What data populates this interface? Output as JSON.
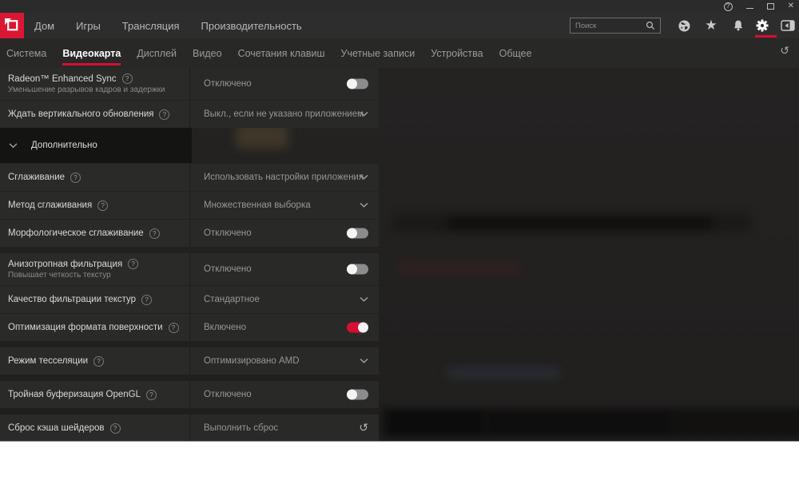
{
  "colors": {
    "accent": "#d60f33",
    "logo_red": "#da1733"
  },
  "titlebar": {
    "help_label": "?",
    "close_label": "✕"
  },
  "navbar": {
    "items": [
      "Дом",
      "Игры",
      "Трансляция",
      "Производительность"
    ],
    "search": {
      "placeholder": "Поиск",
      "icon": "search-icon"
    },
    "icons": [
      "globe-icon",
      "star-icon",
      "bell-icon",
      "gear-icon",
      "side-panel-icon"
    ],
    "active_icon": "gear-icon",
    "star_glyph": "★"
  },
  "tabbar": {
    "tabs": [
      {
        "label": "Система",
        "active": false
      },
      {
        "label": "Видеокарта",
        "active": true
      },
      {
        "label": "Дисплей",
        "active": false
      },
      {
        "label": "Видео",
        "active": false
      },
      {
        "label": "Сочетания клавиш",
        "active": false
      },
      {
        "label": "Учетные записи",
        "active": false
      },
      {
        "label": "Устройства",
        "active": false
      },
      {
        "label": "Общее",
        "active": false
      }
    ],
    "reset_icon_glyph": "↺"
  },
  "settings": {
    "rows": [
      {
        "type": "setting",
        "label": "Radeon™ Enhanced Sync",
        "has_help": true,
        "sublabel": "Уменьшение разрывов кадров и задержки",
        "value": "Отключено",
        "control": "toggle",
        "state": "off"
      },
      {
        "type": "setting",
        "label": "Ждать вертикального обновления",
        "has_help": true,
        "value": "Выкл., если не указано приложением",
        "control": "dropdown"
      },
      {
        "type": "expander",
        "label": "Дополнительно",
        "expanded": true
      },
      {
        "type": "setting",
        "label": "Сглаживание",
        "has_help": true,
        "value": "Использовать настройки приложения",
        "control": "dropdown"
      },
      {
        "type": "setting",
        "label": "Метод сглаживания",
        "has_help": true,
        "value": "Множественная выборка",
        "control": "dropdown"
      },
      {
        "type": "setting",
        "label": "Морфологическое сглаживание",
        "has_help": true,
        "value": "Отключено",
        "control": "toggle",
        "state": "off"
      },
      {
        "type": "setting",
        "label": "Анизотропная фильтрация",
        "has_help": true,
        "sublabel": "Повышает четкость текстур",
        "value": "Отключено",
        "control": "toggle",
        "state": "off",
        "group_break": true
      },
      {
        "type": "setting",
        "label": "Качество фильтрации текстур",
        "has_help": true,
        "value": "Стандартное",
        "control": "dropdown"
      },
      {
        "type": "setting",
        "label": "Оптимизация формата поверхности",
        "has_help": true,
        "value": "Включено",
        "control": "toggle",
        "state": "on"
      },
      {
        "type": "setting",
        "label": "Режим тесселяции",
        "has_help": true,
        "value": "Оптимизировано AMD",
        "control": "dropdown",
        "group_break": true
      },
      {
        "type": "setting",
        "label": "Тройная буферизация OpenGL",
        "has_help": true,
        "value": "Отключено",
        "control": "toggle",
        "state": "off",
        "group_break": true
      },
      {
        "type": "setting",
        "label": "Сброс кэша шейдеров",
        "has_help": true,
        "value": "Выполнить сброс",
        "control": "reset",
        "group_break": true
      }
    ],
    "help_glyph": "?",
    "reset_glyph": "↺"
  }
}
